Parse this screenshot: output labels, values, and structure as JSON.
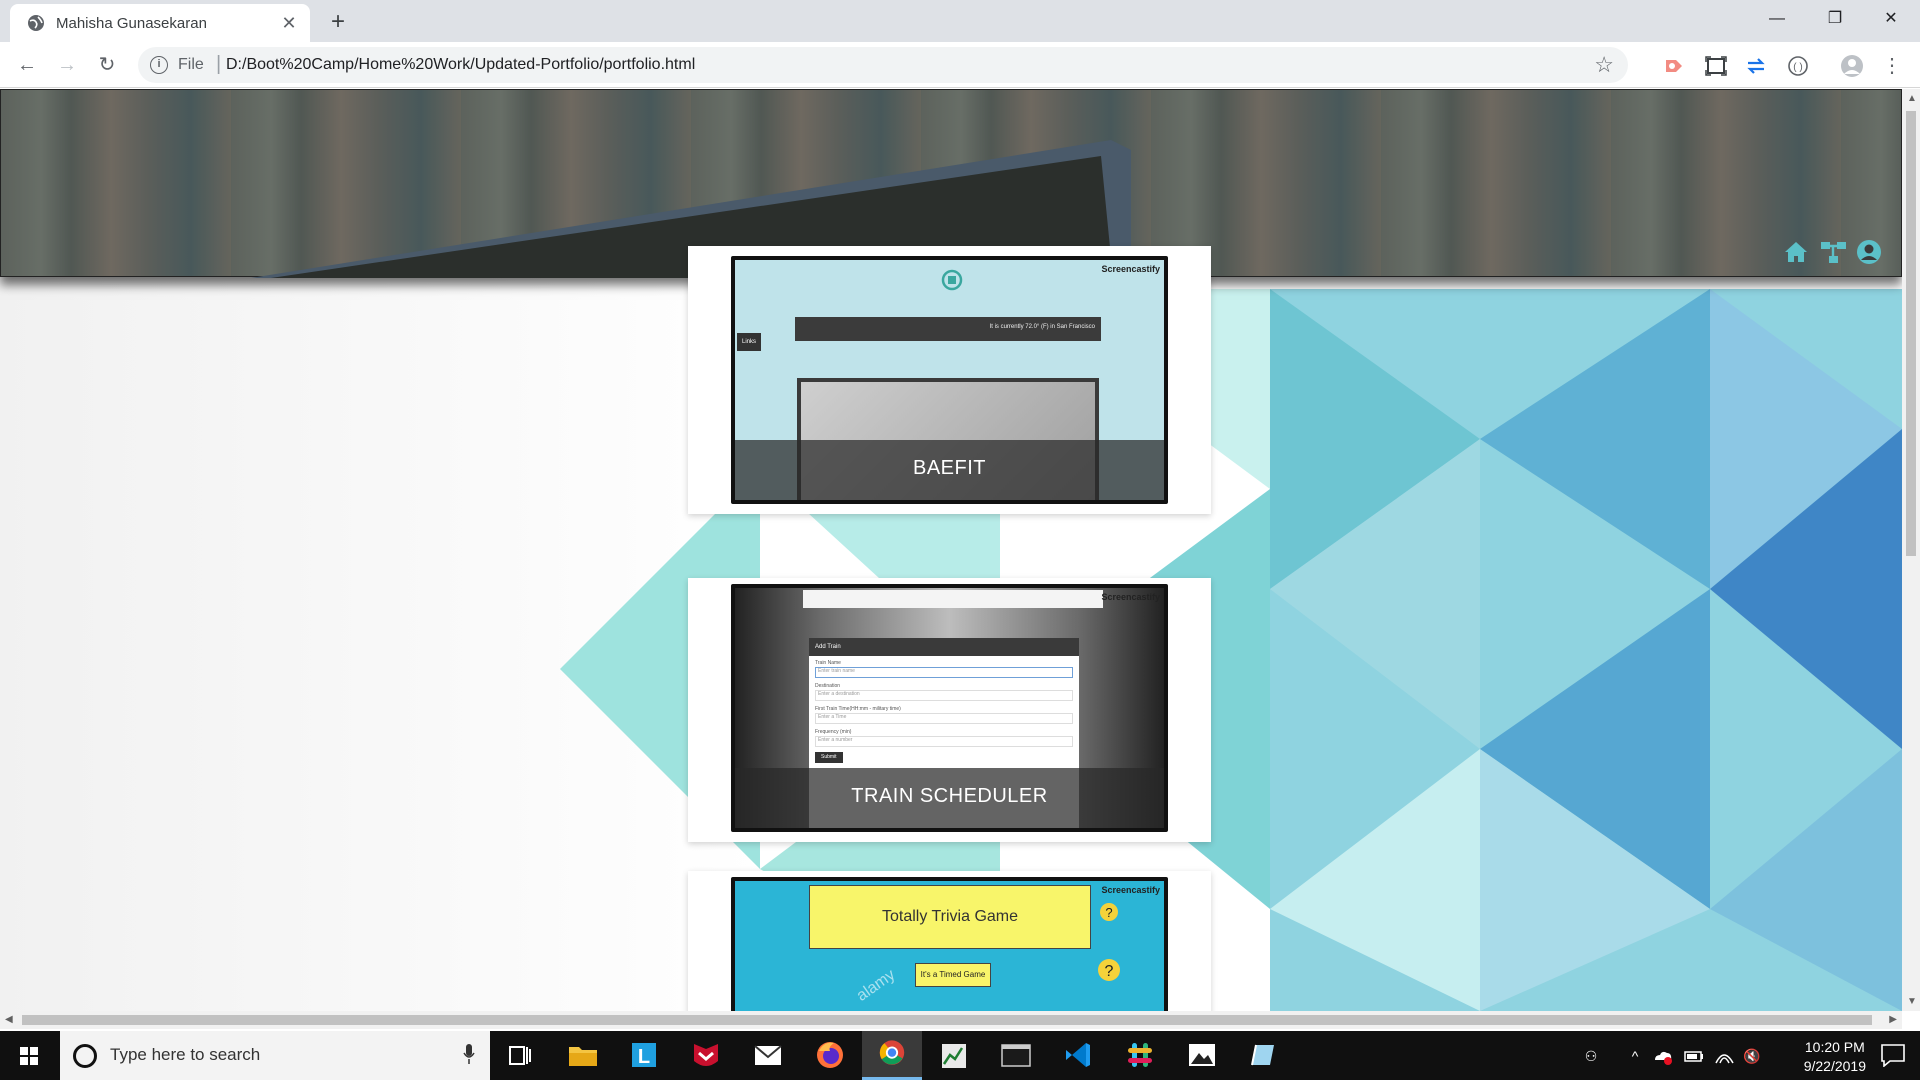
{
  "browser": {
    "tab_title": "Mahisha Gunasekaran",
    "tab_close": "✕",
    "new_tab": "+",
    "url_scheme": "File",
    "url": "D:/Boot%20Camp/Home%20Work/Updated-Portfolio/portfolio.html",
    "window": {
      "minimize": "—",
      "restore": "❐",
      "close": "✕"
    }
  },
  "header": {
    "nav_icons": [
      "home-icon",
      "sitemap-icon",
      "user-icon"
    ],
    "accent": "#5bc0c8"
  },
  "portfolio": {
    "cards": [
      {
        "caption": "BAEFIT",
        "thumb_badge": "Screencastify",
        "thumb_weather": "It is currently 72.0° (F) in San Francisco",
        "thumb_tab": "Links"
      },
      {
        "caption": "TRAIN SCHEDULER",
        "thumb_badge": "Screencastify",
        "form_title": "Add Train",
        "form_labels": [
          "Train Name",
          "Destination",
          "First Train Time(HH:mm - military time)",
          "Frequency (min)"
        ],
        "form_placeholders": [
          "Enter train name",
          "Enter a destination",
          "Enter a Time",
          "Enter a number"
        ],
        "form_submit": "Submit"
      },
      {
        "caption": "",
        "thumb_badge": "Screencastify",
        "game_title": "Totally Trivia Game",
        "game_subtitle": "It's a Timed Game",
        "watermark": "alamy"
      }
    ]
  },
  "taskbar": {
    "search_placeholder": "Type here to search",
    "time": "10:20 PM",
    "date": "9/22/2019",
    "apps": [
      "task-view",
      "file-explorer",
      "l-app",
      "mcafee",
      "mail",
      "firefox",
      "chrome",
      "spreadsheet",
      "terminal",
      "vscode",
      "slack",
      "photos",
      "paint3d"
    ]
  }
}
